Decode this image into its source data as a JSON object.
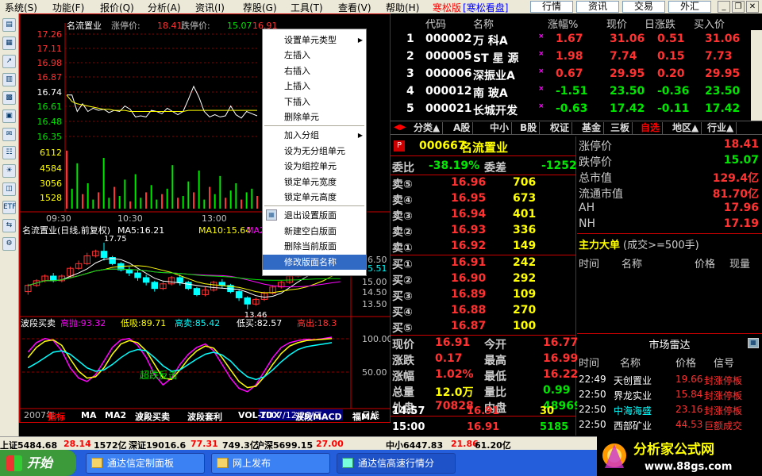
{
  "menu": {
    "items": [
      "系统(S)",
      "功能(F)",
      "报价(Q)",
      "分析(A)",
      "资讯(I)",
      "荐股(G)",
      "工具(T)",
      "查看(V)",
      "帮助(H)"
    ],
    "brand": "寒松版",
    "brand2": "[寒松看盘]",
    "tabs": [
      "行情",
      "资讯",
      "交易",
      "外汇"
    ]
  },
  "left_tools": [
    "▤",
    "▦",
    "↗",
    "▥",
    "▩",
    "▣",
    "✉",
    "☷",
    "☀",
    "◫",
    "ETF",
    "⇆",
    "⚙"
  ],
  "intraday": {
    "title": "名流置业",
    "limit_up_label": "涨停价:",
    "limit_up": "18.41",
    "limit_down_label": "跌停价:",
    "limit_down": "15.07",
    "price": "16.91",
    "change_pct": "1.02%",
    "change_arrow": "▲",
    "prices": [
      "17.26",
      "17.11",
      "16.98",
      "16.87",
      "16.74",
      "16.61",
      "16.48",
      "16.35"
    ],
    "volumes": [
      "6112",
      "4584",
      "3056",
      "1528"
    ],
    "times": [
      "09:30",
      "10:30",
      "13:00"
    ],
    "series": [
      16.7,
      16.7,
      16.55,
      16.62,
      16.55,
      16.58,
      16.56,
      16.57,
      16.54,
      16.56,
      16.55,
      16.6,
      16.57,
      16.5,
      16.51,
      16.5,
      16.56,
      16.55,
      16.53,
      16.58,
      16.55,
      16.52,
      16.55,
      16.66,
      16.78,
      16.68,
      16.55,
      16.5,
      16.52,
      16.5,
      16.51,
      16.6,
      16.52,
      16.49,
      16.55,
      16.53,
      16.51
    ],
    "avg": [
      16.7,
      16.64,
      16.62,
      16.61,
      16.6,
      16.59,
      16.58,
      16.57,
      16.57,
      16.56,
      16.56,
      16.56,
      16.55,
      16.55,
      16.55,
      16.55,
      16.55,
      16.55,
      16.55,
      16.55,
      16.55,
      16.55,
      16.55,
      16.56,
      16.56,
      16.56,
      16.56,
      16.56,
      16.56,
      16.56,
      16.56,
      16.56,
      16.56,
      16.56,
      16.56,
      16.56,
      16.56
    ],
    "vol": [
      3.2,
      1.1,
      2.5,
      0.8,
      1.4,
      0.5,
      0.9,
      2.8,
      0.6,
      1.2,
      0.7,
      1.6,
      0.4,
      1.9,
      0.6,
      0.9,
      1.3,
      0.5,
      0.8,
      1.1,
      2.4,
      0.6,
      0.7,
      1.5,
      0.9,
      2.1,
      0.5,
      1.2,
      0.8,
      1.8,
      0.6,
      1.0,
      1.4,
      0.5,
      0.9,
      1.1,
      0.7
    ]
  },
  "daily": {
    "title": "名流置业(日线,前复权)",
    "ma5": "MA5:16.21",
    "ma10": "MA10:15.64",
    "ma20": "MA2",
    "high_label": "17.75",
    "low_label": "13.46",
    "right_prices": [
      "16.50",
      "15.51",
      "15.00",
      "14.50",
      "13.50"
    ],
    "dates": [
      "2007年",
      "12"
    ],
    "cur_date": "2007/12/26/三",
    "period": "日线",
    "candles": [
      [
        14.6,
        15.0,
        14.4,
        15.1
      ],
      [
        15.0,
        15.3,
        14.9,
        15.4
      ],
      [
        15.3,
        15.6,
        15.2,
        15.7
      ],
      [
        15.6,
        15.3,
        15.2,
        15.8
      ],
      [
        15.3,
        15.6,
        15.2,
        15.7
      ],
      [
        15.6,
        16.1,
        15.5,
        16.2
      ],
      [
        16.1,
        16.4,
        16.0,
        16.6
      ],
      [
        16.4,
        16.9,
        16.3,
        17.1
      ],
      [
        16.9,
        17.2,
        16.8,
        17.3
      ],
      [
        17.2,
        16.8,
        16.6,
        17.75
      ],
      [
        16.8,
        16.4,
        16.3,
        16.9
      ],
      [
        16.4,
        16.0,
        15.9,
        16.5
      ],
      [
        16.0,
        15.8,
        15.6,
        16.2
      ],
      [
        15.8,
        15.5,
        15.3,
        16.0
      ],
      [
        15.5,
        15.2,
        15.0,
        15.7
      ],
      [
        15.2,
        14.8,
        14.6,
        15.3
      ],
      [
        14.8,
        15.1,
        14.7,
        15.3
      ],
      [
        15.1,
        15.5,
        15.0,
        15.6
      ],
      [
        15.5,
        15.2,
        15.0,
        15.7
      ],
      [
        15.2,
        14.8,
        14.7,
        15.3
      ],
      [
        14.8,
        14.4,
        14.3,
        14.9
      ],
      [
        14.4,
        14.7,
        14.3,
        14.9
      ],
      [
        14.7,
        15.2,
        14.6,
        15.3
      ],
      [
        15.2,
        15.0,
        14.8,
        15.4
      ],
      [
        15.0,
        14.6,
        14.5,
        15.1
      ],
      [
        14.6,
        14.2,
        14.0,
        14.7
      ],
      [
        14.2,
        13.8,
        13.46,
        14.3
      ],
      [
        13.8,
        14.1,
        13.7,
        14.2
      ],
      [
        14.1,
        14.5,
        14.0,
        14.6
      ],
      [
        14.5,
        14.9,
        14.4,
        15.0
      ],
      [
        14.9,
        15.2,
        14.8,
        15.3
      ],
      [
        15.2,
        15.6,
        15.1,
        15.7
      ],
      [
        15.6,
        15.9,
        15.5,
        16.0
      ],
      [
        15.9,
        16.2,
        15.8,
        16.3
      ],
      [
        16.2,
        16.5,
        16.1,
        16.6
      ],
      [
        16.5,
        16.3,
        16.1,
        16.7
      ],
      [
        16.3,
        16.7,
        16.2,
        16.8
      ],
      [
        16.7,
        16.9,
        16.6,
        17.0
      ]
    ]
  },
  "indicator": {
    "name": "波段买卖",
    "items": [
      "高抛:93.32",
      "低吸:89.71",
      "高卖:85.42",
      "低买:82.57",
      "高出:18.3"
    ],
    "levels": [
      "100.00",
      "50.00"
    ],
    "annotation": "超跌反击",
    "line1": [
      78,
      92,
      98,
      95,
      80,
      55,
      40,
      35,
      45,
      65,
      85,
      96,
      98,
      88,
      70,
      45,
      30,
      40,
      60,
      75,
      85,
      90,
      80,
      60,
      40,
      25,
      20,
      30,
      50,
      70,
      85,
      92,
      95,
      97,
      96,
      98,
      100
    ],
    "line2": [
      70,
      85,
      94,
      96,
      88,
      68,
      50,
      40,
      42,
      55,
      75,
      90,
      95,
      92,
      80,
      60,
      40,
      38,
      52,
      68,
      80,
      87,
      84,
      70,
      52,
      35,
      26,
      28,
      42,
      60,
      76,
      87,
      92,
      95,
      96,
      97,
      98
    ],
    "line3": [
      55,
      62,
      70,
      78,
      80,
      75,
      65,
      55,
      50,
      52,
      60,
      70,
      78,
      82,
      80,
      70,
      58,
      50,
      52,
      60,
      68,
      75,
      78,
      74,
      65,
      52,
      42,
      38,
      42,
      52,
      64,
      74,
      82,
      86,
      88,
      90,
      92
    ]
  },
  "bottom_tabs": [
    "指标",
    "MA",
    "MA2",
    "波段买卖",
    "波段套利",
    "VOL-TDX",
    "波段MACD",
    "福MA"
  ],
  "context_menu": {
    "items": [
      {
        "label": "设置单元类型",
        "sub": true
      },
      {
        "label": "左插入"
      },
      {
        "label": "右插入"
      },
      {
        "label": "上插入"
      },
      {
        "label": "下插入"
      },
      {
        "label": "删除单元"
      },
      {
        "sep": true
      },
      {
        "label": "加入分组",
        "sub": true
      },
      {
        "label": "设为无分组单元"
      },
      {
        "label": "设为组控单元"
      },
      {
        "label": "锁定单元宽度"
      },
      {
        "label": "锁定单元高度"
      },
      {
        "sep": true
      },
      {
        "label": "退出设置版面",
        "icon": true
      },
      {
        "label": "新建空白版面"
      },
      {
        "label": "删除当前版面"
      },
      {
        "label": "修改版面名称",
        "hl": true
      }
    ]
  },
  "quote_table": {
    "headers": [
      "代码",
      "名称",
      "涨幅%",
      "现价",
      "日涨跌",
      "买入价"
    ],
    "rows": [
      {
        "n": "1",
        "code": "000002",
        "name": "万  科A",
        "pct": "1.67",
        "price": "31.06",
        "chg": "0.51",
        "bid": "31.06",
        "up": true
      },
      {
        "n": "2",
        "code": "000005",
        "name": "ST 星 源",
        "pct": "1.98",
        "price": "7.74",
        "chg": "0.15",
        "bid": "7.73",
        "up": true
      },
      {
        "n": "3",
        "code": "000006",
        "name": "深振业A",
        "pct": "0.67",
        "price": "29.95",
        "chg": "0.20",
        "bid": "29.95",
        "up": true
      },
      {
        "n": "4",
        "code": "000012",
        "name": "南  玻A",
        "pct": "-1.51",
        "price": "23.50",
        "chg": "-0.36",
        "bid": "23.50",
        "up": false
      },
      {
        "n": "5",
        "code": "000021",
        "name": "长城开发",
        "pct": "-0.63",
        "price": "17.42",
        "chg": "-0.11",
        "bid": "17.42",
        "up": false
      }
    ]
  },
  "category_tabs": [
    "分类▲",
    "A股",
    "中小",
    "B股",
    "权证",
    "基金",
    "三板",
    "自选",
    "地区▲",
    "行业▲"
  ],
  "stock": {
    "code": "000667",
    "name": "名流置业",
    "wb_label": "委比",
    "wb": "-38.19%",
    "wc_label": "委差",
    "wc": "-1252",
    "sells": [
      [
        "卖⑤",
        "16.96",
        "706"
      ],
      [
        "卖④",
        "16.95",
        "673"
      ],
      [
        "卖③",
        "16.94",
        "401"
      ],
      [
        "卖②",
        "16.93",
        "336"
      ],
      [
        "卖①",
        "16.92",
        "149"
      ]
    ],
    "buys": [
      [
        "买①",
        "16.91",
        "242"
      ],
      [
        "买②",
        "16.90",
        "292"
      ],
      [
        "买③",
        "16.89",
        "109"
      ],
      [
        "买④",
        "16.88",
        "270"
      ],
      [
        "买⑤",
        "16.87",
        "100"
      ]
    ],
    "stats": [
      [
        "现价",
        "16.91",
        "今开",
        "16.77"
      ],
      [
        "涨跌",
        "0.17",
        "最高",
        "16.99"
      ],
      [
        "涨幅",
        "1.02%",
        "最低",
        "16.22"
      ],
      [
        "总量",
        "12.0万",
        "量比",
        "0.99"
      ],
      [
        "外盘",
        "70828",
        "内盘",
        "48969"
      ]
    ],
    "ticks": [
      [
        "14:57",
        "16.91",
        "30"
      ],
      [
        "15:00",
        "16.91",
        "5185"
      ]
    ]
  },
  "info": {
    "rows": [
      [
        "涨停价",
        "18.41"
      ],
      [
        "跌停价",
        "15.07"
      ],
      [
        "总市值",
        "129.4亿"
      ],
      [
        "流通市值",
        "81.70亿"
      ],
      [
        "AH",
        "17.96"
      ],
      [
        "NH",
        "17.19"
      ]
    ],
    "big_title": "主力大单",
    "big_sub": "(成交>=500手)",
    "big_headers": [
      "时间",
      "名称",
      "价格",
      "现量"
    ]
  },
  "radar": {
    "title": "市场雷达",
    "headers": [
      "时间",
      "名称",
      "价格",
      "信号"
    ],
    "rows": [
      [
        "22:49",
        "天创置业",
        "19.66",
        "封涨停板"
      ],
      [
        "22:50",
        "界龙实业",
        "15.84",
        "封涨停板"
      ],
      [
        "22:50",
        "中海海盛",
        "23.16",
        "封涨停板"
      ],
      [
        "22:50",
        "西部矿业",
        "44.53",
        "巨额成交"
      ]
    ]
  },
  "status": {
    "items": [
      "上证5484.68",
      "28.14",
      "1572亿",
      "深证19016.6",
      "77.31",
      "749.3亿",
      "沪深5699.15",
      "27.00",
      "中小6447.83",
      "21.86",
      "61.20亿"
    ]
  },
  "taskbar": {
    "start": "开始",
    "tasks": [
      "通达信定制面板",
      "网上发布",
      "通达信高速行情分"
    ]
  },
  "logo": {
    "title": "分析家公式网",
    "url": "www.88gs.com"
  },
  "colors": {
    "up": "#ff3232",
    "down": "#00e600",
    "label": "#c0c0c0",
    "yellow": "#ffff00",
    "cyan": "#00ffff",
    "grid": "#8b0000"
  }
}
